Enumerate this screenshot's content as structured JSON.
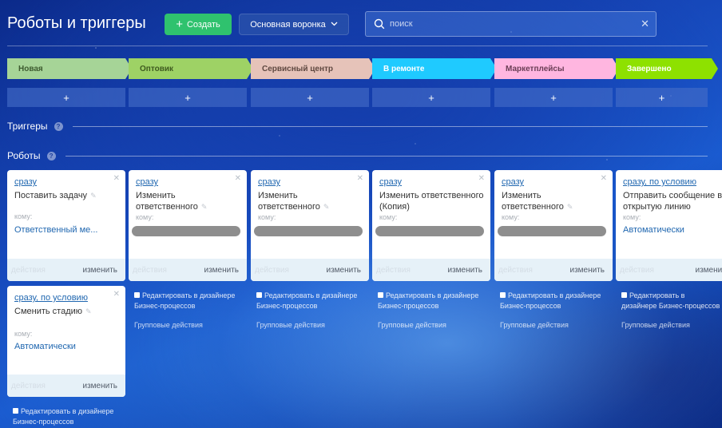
{
  "header": {
    "title": "Роботы и триггеры",
    "create_label": "Создать",
    "funnel_label": "Основная воронка",
    "search_placeholder": "поиск"
  },
  "stages": [
    {
      "label": "Новая",
      "color": "#a6d497",
      "text_color": "#3d5b2f"
    },
    {
      "label": "Оптовик",
      "color": "#9ed265",
      "text_color": "#3e5a1f"
    },
    {
      "label": "Сервисный центр",
      "color": "#e6c3b9",
      "text_color": "#5f4840"
    },
    {
      "label": "В ремонте",
      "color": "#1fcaff",
      "text_color": "#ffffff"
    },
    {
      "label": "Маркетплейсы",
      "color": "#ffb6e0",
      "text_color": "#6a3d55"
    },
    {
      "label": "Завершено",
      "color": "#8ee100",
      "text_color": "#ffffff"
    }
  ],
  "add_label": "+",
  "sections": {
    "triggers": "Триггеры",
    "robots": "Роботы",
    "help": "?"
  },
  "robots_row1": [
    {
      "trigger": "сразу",
      "name": "Поставить задачу",
      "to_label": "кому:",
      "responsible": "Ответственный ме...",
      "actions": "действия",
      "change": "изменить"
    },
    {
      "trigger": "сразу",
      "name": "Изменить ответственного",
      "to_label": "кому:",
      "actions": "действия",
      "change": "изменить"
    },
    {
      "trigger": "сразу",
      "name": "Изменить ответственного",
      "to_label": "кому:",
      "actions": "действия",
      "change": "изменить"
    },
    {
      "trigger": "сразу",
      "name": "Изменить ответственного (Копия)",
      "to_label": "кому:",
      "actions": "действия",
      "change": "изменить"
    },
    {
      "trigger": "сразу",
      "name": "Изменить ответственного",
      "to_label": "кому:",
      "actions": "действия",
      "change": "изменить"
    },
    {
      "trigger": "сразу, по условию",
      "name": "Отправить сообщение в открытую линию",
      "to_label": "кому:",
      "responsible": "Автоматически",
      "actions": "действия",
      "change": "изменить"
    }
  ],
  "robots_row2": [
    {
      "trigger": "сразу, по условию",
      "name": "Сменить стадию",
      "to_label": "кому:",
      "responsible": "Автоматически",
      "actions": "действия",
      "change": "изменить"
    }
  ],
  "bp_designer": "Редактировать в дизайнере Бизнес-процессов",
  "group_actions": "Групповые действия"
}
